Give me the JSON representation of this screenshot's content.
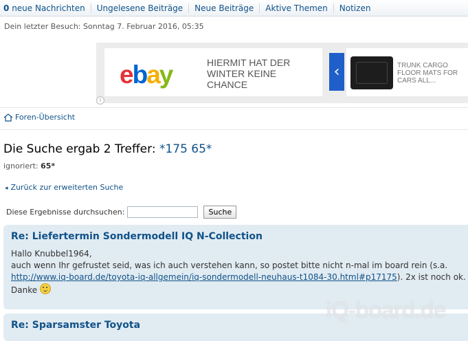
{
  "topnav": {
    "new_messages_count": "0",
    "new_messages_label": "neue Nachrichten",
    "items": [
      "Ungelesene Beiträge",
      "Neue Beiträge",
      "Aktive Themen",
      "Notizen"
    ]
  },
  "last_visit": "Dein letzter Besuch: Sonntag 7. Februar 2016, 05:35",
  "ad": {
    "logo": {
      "e": "e",
      "b": "b",
      "a": "a",
      "y": "y"
    },
    "text1": "HIERMIT HAT DER WINTER KEINE CHANCE",
    "arrow": "‹",
    "text2": "TRUNK CARGO FLOOR MATS FOR CARS ALL...",
    "info": "i"
  },
  "breadcrumb": {
    "label": "Foren-Übersicht",
    "icon": "home-icon"
  },
  "search": {
    "title_prefix": "Die Suche ergab 2 Treffer: ",
    "term": "*175 65*",
    "ignored_label": "ignoriert: ",
    "ignored_value": "65*",
    "back_label": "Zurück zur erweiterten Suche",
    "filter_label": "Diese Ergebnisse durchsuchen:",
    "filter_value": "",
    "button_label": "Suche"
  },
  "posts": [
    {
      "title": "Re: Liefertermin Sondermodell IQ N-Collection",
      "line1": "Hallo Knubbel1964,",
      "line2": "auch wenn Ihr gefrustet seid, was ich auch verstehen kann, so postet bitte nicht n-mal im board rein (s.a.",
      "link": "http://www.iq-board.de/toyota-iq-allgemein/iq-sondermodell-neuhaus-t1084-30.html#p17175",
      "line3_tail": "). 2x ist noch ok.",
      "line4": "Danke",
      "smiley": "wink-smiley-icon"
    },
    {
      "title": "Re: Sparsamster Toyota"
    }
  ],
  "watermark": "iQ-board.de",
  "colors": {
    "link": "#105289",
    "post_bg": "#e1ebf2",
    "ad_arrow": "#1f5fc9"
  }
}
